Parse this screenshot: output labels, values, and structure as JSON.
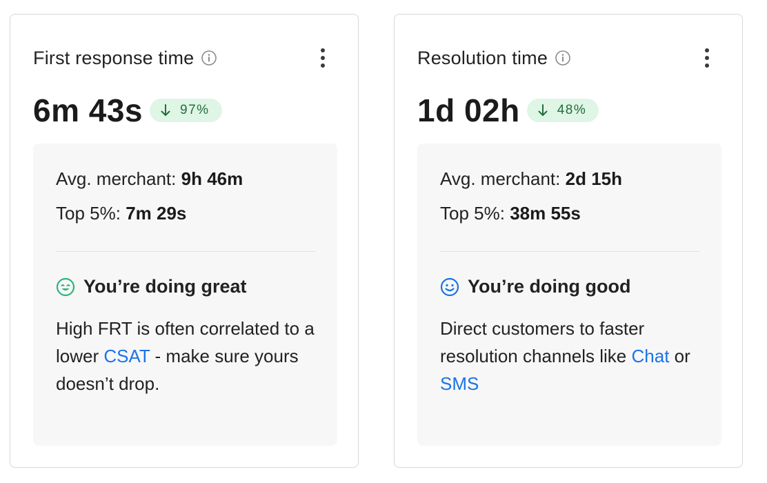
{
  "cards": [
    {
      "title": "First response time",
      "value": "6m 43s",
      "change": "97%",
      "avg_label": "Avg. merchant:",
      "avg_value": "9h 46m",
      "top_label": "Top 5%:",
      "top_value": "7m 29s",
      "status": "You’re doing great",
      "status_color": "#2fb37c",
      "status_icon": "grin-face-icon",
      "body_before": "High FRT is often correlated to a lower ",
      "link1": "CSAT",
      "body_after": " - make sure yours doesn’t drop."
    },
    {
      "title": "Resolution time",
      "value": "1d 02h",
      "change": "48%",
      "avg_label": "Avg. merchant:",
      "avg_value": "2d 15h",
      "top_label": "Top 5%:",
      "top_value": "38m 55s",
      "status": "You’re doing good",
      "status_color": "#1a73e8",
      "status_icon": "smile-face-icon",
      "body_before": "Direct customers to faster resolution channels like ",
      "link1": "Chat",
      "body_middle": " or ",
      "link2": "SMS"
    }
  ],
  "colors": {
    "link": "#1a73e8",
    "badge_bg": "#dff5e5",
    "badge_text": "#1f6e3a"
  }
}
